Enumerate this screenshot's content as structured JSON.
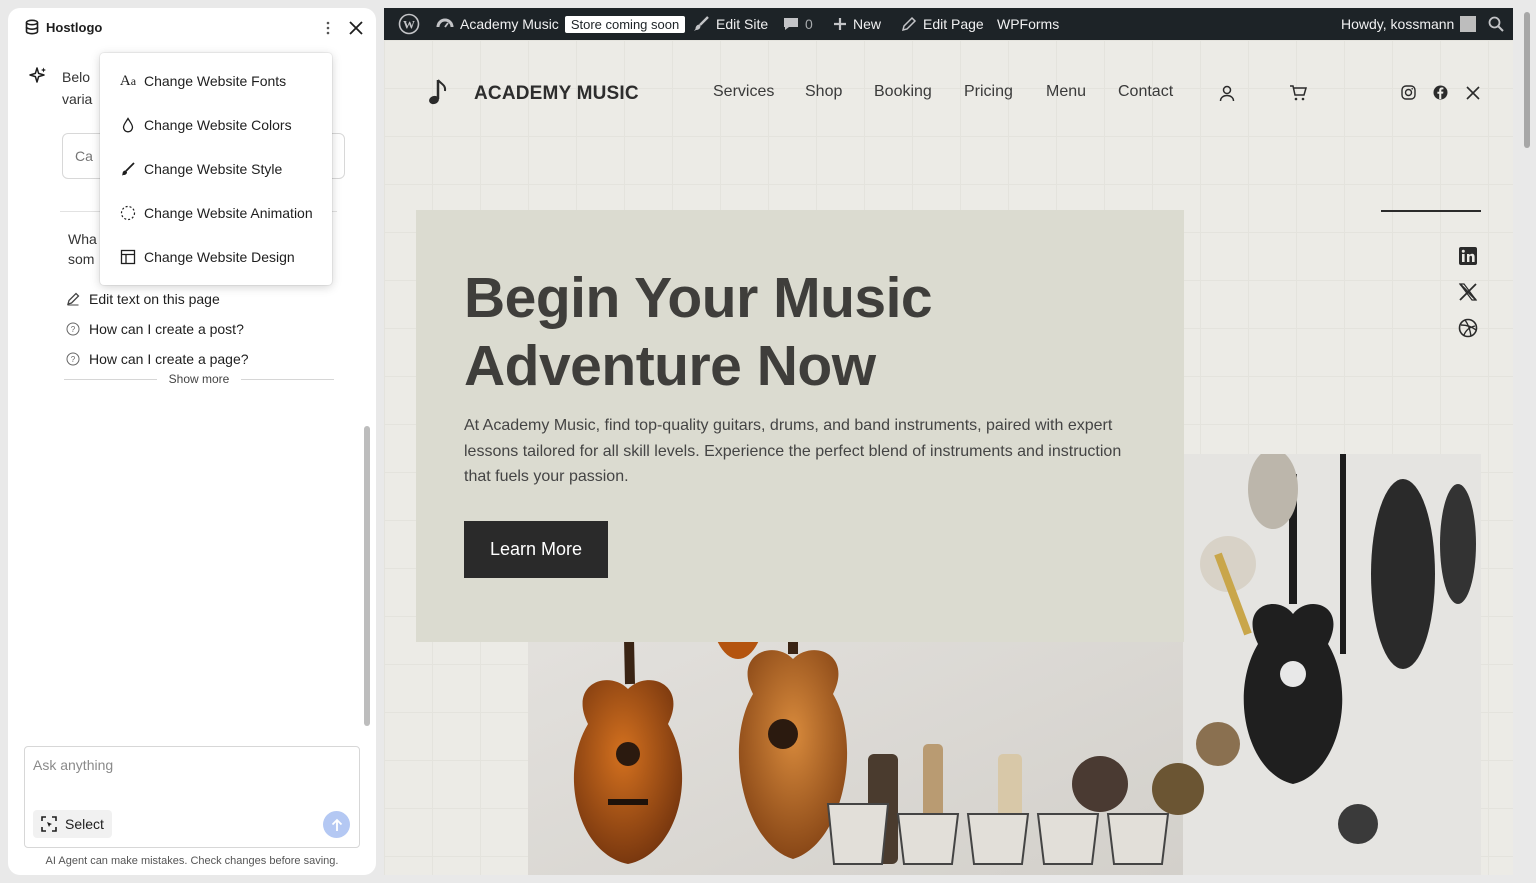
{
  "panel": {
    "brand": "Hostlogo",
    "intro_partial": "Belo\nvaria",
    "category_placeholder": "Ca",
    "what_partial": "Wha\nsom",
    "suggestions": [
      {
        "label": "Edit text on this page",
        "icon": "pencil-icon"
      },
      {
        "label": "How can I create a post?",
        "icon": "question-circle-icon"
      },
      {
        "label": "How can I create a page?",
        "icon": "question-circle-icon"
      }
    ],
    "show_more": "Show more",
    "ask_placeholder": "Ask anything",
    "select_label": "Select",
    "disclaimer": "AI Agent can make mistakes. Check changes before saving."
  },
  "menu": {
    "items": [
      {
        "label": "Change Website Fonts",
        "icon": "font-icon"
      },
      {
        "label": "Change Website Colors",
        "icon": "droplet-icon"
      },
      {
        "label": "Change Website Style",
        "icon": "brush-icon"
      },
      {
        "label": "Change Website Animation",
        "icon": "dashed-circle-icon"
      },
      {
        "label": "Change Website Design",
        "icon": "layout-icon"
      }
    ]
  },
  "adminbar": {
    "site_name": "Academy Music",
    "badge": "Store coming soon",
    "edit_site": "Edit Site",
    "comments_count": "0",
    "new_label": "New",
    "edit_page": "Edit Page",
    "wpforms": "WPForms",
    "howdy": "Howdy, kossmann"
  },
  "site": {
    "title": "ACADEMY MUSIC",
    "nav": [
      "Services",
      "Shop",
      "Booking",
      "Pricing",
      "Menu",
      "Contact"
    ],
    "hero_title": "Begin Your Music Adventure Now",
    "hero_desc": "At Academy Music, find top-quality guitars, drums, and band instruments, paired with expert lessons tailored for all skill levels. Experience the perfect blend of instruments and instruction that fuels your passion.",
    "hero_button": "Learn More"
  },
  "colors": {
    "admin_bar": "#1d2327",
    "hero_card": "#dbdbd0",
    "button": "#2a2a2a",
    "send_button": "#b4c8f3"
  }
}
